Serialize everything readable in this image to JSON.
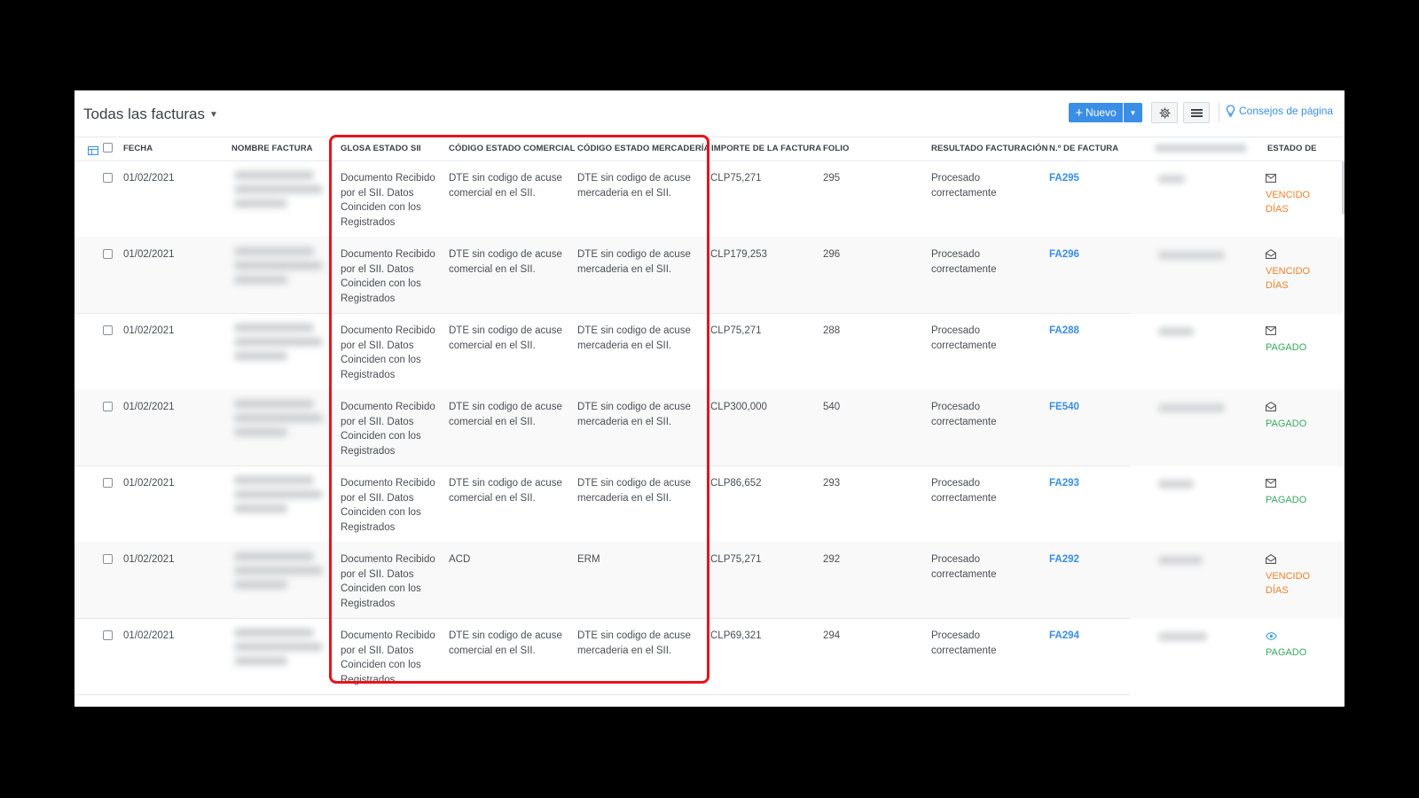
{
  "page": {
    "title": "Todas las facturas",
    "new_button": "Nuevo",
    "tips_link": "Consejos de página"
  },
  "columns": {
    "fecha": "FECHA",
    "nombre": "NOMBRE FACTURA",
    "glosa": "GLOSA ESTADO SII",
    "comercial": "CÓDIGO ESTADO COMERCIAL",
    "mercaderia": "CÓDIGO ESTADO MERCADERÍA",
    "importe": "IMPORTE DE LA FACTURA",
    "folio": "FOLIO",
    "resultado": "RESULTADO FACTURACIÓN",
    "numero": "N.º DE FACTURA",
    "estado": "ESTADO DE"
  },
  "rows": [
    {
      "fecha": "01/02/2021",
      "glosa": "Documento Recibido por el SII. Datos Coinciden con los Registrados",
      "comercial": "DTE sin codigo de acuse comercial en el SII.",
      "mercaderia": "DTE sin codigo de acuse mercaderia en el SII.",
      "importe": "CLP75,271",
      "folio": "295",
      "resultado": "Procesado correctamente",
      "numero": "FA295",
      "estado": "VENCIDO",
      "estado2": "DÍAS",
      "estado_kind": "overdue",
      "icon": "mail-closed-icon"
    },
    {
      "fecha": "01/02/2021",
      "glosa": "Documento Recibido por el SII. Datos Coinciden con los Registrados",
      "comercial": "DTE sin codigo de acuse comercial en el SII.",
      "mercaderia": "DTE sin codigo de acuse mercaderia en el SII.",
      "importe": "CLP179,253",
      "folio": "296",
      "resultado": "Procesado correctamente",
      "numero": "FA296",
      "estado": "VENCIDO",
      "estado2": "DÍAS",
      "estado_kind": "overdue",
      "icon": "mail-open-icon"
    },
    {
      "fecha": "01/02/2021",
      "glosa": "Documento Recibido por el SII. Datos Coinciden con los Registrados",
      "comercial": "DTE sin codigo de acuse comercial en el SII.",
      "mercaderia": "DTE sin codigo de acuse mercaderia en el SII.",
      "importe": "CLP75,271",
      "folio": "288",
      "resultado": "Procesado correctamente",
      "numero": "FA288",
      "estado": "PAGADO",
      "estado2": "",
      "estado_kind": "paid",
      "icon": "mail-closed-icon"
    },
    {
      "fecha": "01/02/2021",
      "glosa": "Documento Recibido por el SII. Datos Coinciden con los Registrados",
      "comercial": "DTE sin codigo de acuse comercial en el SII.",
      "mercaderia": "DTE sin codigo de acuse mercaderia en el SII.",
      "importe": "CLP300,000",
      "folio": "540",
      "resultado": "Procesado correctamente",
      "numero": "FE540",
      "estado": "PAGADO",
      "estado2": "",
      "estado_kind": "paid",
      "icon": "mail-open-icon"
    },
    {
      "fecha": "01/02/2021",
      "glosa": "Documento Recibido por el SII. Datos Coinciden con los Registrados",
      "comercial": "DTE sin codigo de acuse comercial en el SII.",
      "mercaderia": "DTE sin codigo de acuse mercaderia en el SII.",
      "importe": "CLP86,652",
      "folio": "293",
      "resultado": "Procesado correctamente",
      "numero": "FA293",
      "estado": "PAGADO",
      "estado2": "",
      "estado_kind": "paid",
      "icon": "mail-closed-icon"
    },
    {
      "fecha": "01/02/2021",
      "glosa": "Documento Recibido por el SII. Datos Coinciden con los Registrados",
      "comercial": "ACD",
      "mercaderia": "ERM",
      "importe": "CLP75,271",
      "folio": "292",
      "resultado": "Procesado correctamente",
      "numero": "FA292",
      "estado": "VENCIDO",
      "estado2": "DÍAS",
      "estado_kind": "overdue",
      "icon": "mail-open-icon"
    },
    {
      "fecha": "01/02/2021",
      "glosa": "Documento Recibido por el SII. Datos Coinciden con los Registrados",
      "comercial": "DTE sin codigo de acuse comercial en el SII.",
      "mercaderia": "DTE sin codigo de acuse mercaderia en el SII.",
      "importe": "CLP69,321",
      "folio": "294",
      "resultado": "Procesado correctamente",
      "numero": "FA294",
      "estado": "PAGADO",
      "estado2": "",
      "estado_kind": "paid",
      "icon": "eye-icon"
    }
  ],
  "colors": {
    "accent": "#3a8ee6",
    "overdue": "#f0822d",
    "paid": "#3aaa5c",
    "highlight": "#e8131c"
  }
}
